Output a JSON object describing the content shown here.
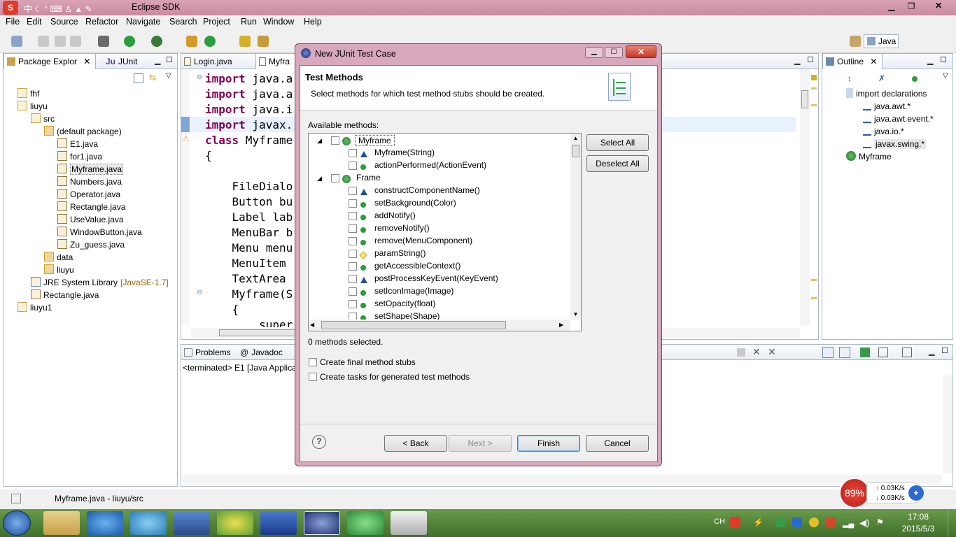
{
  "window": {
    "title": "Eclipse SDK"
  },
  "menu": [
    "File",
    "Edit",
    "Source",
    "Refactor",
    "Navigate",
    "Search",
    "Project",
    "Run",
    "Window",
    "Help"
  ],
  "perspective": {
    "label": "Java"
  },
  "left_panel": {
    "tabs": [
      "Package Explor",
      "JUnit"
    ],
    "tree": [
      {
        "label": "fhf",
        "indent": 0,
        "icon": "project-icon"
      },
      {
        "label": "liuyu",
        "indent": 0,
        "icon": "project-icon"
      },
      {
        "label": "src",
        "indent": 1,
        "icon": "source-folder-icon"
      },
      {
        "label": "(default package)",
        "indent": 2,
        "icon": "package-icon"
      },
      {
        "label": "E1.java",
        "indent": 3,
        "icon": "java-file-icon"
      },
      {
        "label": "for1.java",
        "indent": 3,
        "icon": "java-file-icon"
      },
      {
        "label": "Myframe.java",
        "indent": 3,
        "icon": "java-file-icon",
        "selected": true
      },
      {
        "label": "Numbers.java",
        "indent": 3,
        "icon": "java-file-icon"
      },
      {
        "label": "Operator.java",
        "indent": 3,
        "icon": "java-file-icon"
      },
      {
        "label": "Rectangle.java",
        "indent": 3,
        "icon": "java-file-icon"
      },
      {
        "label": "UseValue.java",
        "indent": 3,
        "icon": "java-file-icon"
      },
      {
        "label": "WindowButton.java",
        "indent": 3,
        "icon": "java-file-icon"
      },
      {
        "label": "Zu_guess.java",
        "indent": 3,
        "icon": "java-file-icon"
      },
      {
        "label": "data",
        "indent": 2,
        "icon": "package-icon"
      },
      {
        "label": "liuyu",
        "indent": 2,
        "icon": "package-icon"
      },
      {
        "label": "JRE System Library",
        "suffix": "[JavaSE-1.7]",
        "indent": 1,
        "icon": "library-icon"
      },
      {
        "label": "Rectangle.java",
        "indent": 1,
        "icon": "java-file-icon"
      },
      {
        "label": "liuyu1",
        "indent": 0,
        "icon": "project-icon"
      }
    ]
  },
  "editor": {
    "tabs": [
      "Login.java",
      "Myfra"
    ],
    "lines": [
      {
        "kw": "import",
        "rest": " java.a"
      },
      {
        "kw": "import",
        "rest": " java.a"
      },
      {
        "kw": "import",
        "rest": " java.i"
      },
      {
        "kw": "import",
        "rest": " javax."
      },
      {
        "kw": "class",
        "rest": " Myframe"
      },
      {
        "kw": "",
        "rest": "{"
      },
      {
        "kw": "",
        "rest": ""
      },
      {
        "kw": "",
        "rest": "    FileDialo"
      },
      {
        "kw": "",
        "rest": "    Button bu"
      },
      {
        "kw": "",
        "rest": "    Label lab"
      },
      {
        "kw": "",
        "rest": "    MenuBar b"
      },
      {
        "kw": "",
        "rest": "    Menu menu"
      },
      {
        "kw": "",
        "rest": "    MenuItem "
      },
      {
        "kw": "",
        "rest": "    TextArea "
      },
      {
        "kw": "",
        "rest": "    Myframe(S"
      },
      {
        "kw": "",
        "rest": "    {"
      },
      {
        "kw": "",
        "rest": "        super"
      }
    ]
  },
  "outline": {
    "tab": "Outline",
    "items": [
      {
        "label": "import declarations",
        "indent": 0
      },
      {
        "label": "java.awt.*",
        "indent": 1
      },
      {
        "label": "java.awt.event.*",
        "indent": 1
      },
      {
        "label": "java.io.*",
        "indent": 1
      },
      {
        "label": "javax.swing.*",
        "indent": 1,
        "selected": true
      },
      {
        "label": "Myframe",
        "indent": 0
      }
    ]
  },
  "console": {
    "tabs": [
      "Problems",
      "Javadoc"
    ],
    "status_line": "<terminated> E1 [Java Applica"
  },
  "statusbar": {
    "text": "Myframe.java - liuyu/src"
  },
  "dialog": {
    "title": "New JUnit Test Case",
    "heading": "Test Methods",
    "description": "Select methods for which test method stubs should be created.",
    "available_label": "Available methods:",
    "tree": [
      {
        "label": "Myframe",
        "level": 0,
        "icon": "class-icon",
        "expanded": true,
        "selected": true
      },
      {
        "label": "Myframe(String)",
        "level": 1,
        "icon": "constructor-icon"
      },
      {
        "label": "actionPerformed(ActionEvent)",
        "level": 1,
        "icon": "public-method-icon"
      },
      {
        "label": "Frame",
        "level": 0,
        "icon": "class-icon",
        "expanded": true
      },
      {
        "label": "constructComponentName()",
        "level": 1,
        "icon": "default-method-icon"
      },
      {
        "label": "setBackground(Color)",
        "level": 1,
        "icon": "public-method-icon"
      },
      {
        "label": "addNotify()",
        "level": 1,
        "icon": "public-method-icon"
      },
      {
        "label": "removeNotify()",
        "level": 1,
        "icon": "public-method-icon"
      },
      {
        "label": "remove(MenuComponent)",
        "level": 1,
        "icon": "public-method-icon"
      },
      {
        "label": "paramString()",
        "level": 1,
        "icon": "protected-method-icon"
      },
      {
        "label": "getAccessibleContext()",
        "level": 1,
        "icon": "public-method-icon"
      },
      {
        "label": "postProcessKeyEvent(KeyEvent)",
        "level": 1,
        "icon": "default-method-icon"
      },
      {
        "label": "setIconImage(Image)",
        "level": 1,
        "icon": "public-method-icon"
      },
      {
        "label": "setOpacity(float)",
        "level": 1,
        "icon": "public-method-icon"
      },
      {
        "label": "setShape(Shape)",
        "level": 1,
        "icon": "public-method-icon"
      }
    ],
    "select_all": "Select All",
    "deselect_all": "Deselect All",
    "selected_count": "0 methods selected.",
    "opt_final": "Create final method stubs",
    "opt_tasks": "Create tasks for generated test methods",
    "back": "< Back",
    "next": "Next >",
    "finish": "Finish",
    "cancel": "Cancel"
  },
  "netmon": {
    "percent": "89%",
    "up": "0.03K/s",
    "down": "0.03K/s"
  },
  "tray": {
    "lang": "CH",
    "time": "17:08",
    "date": "2015/5/3"
  }
}
